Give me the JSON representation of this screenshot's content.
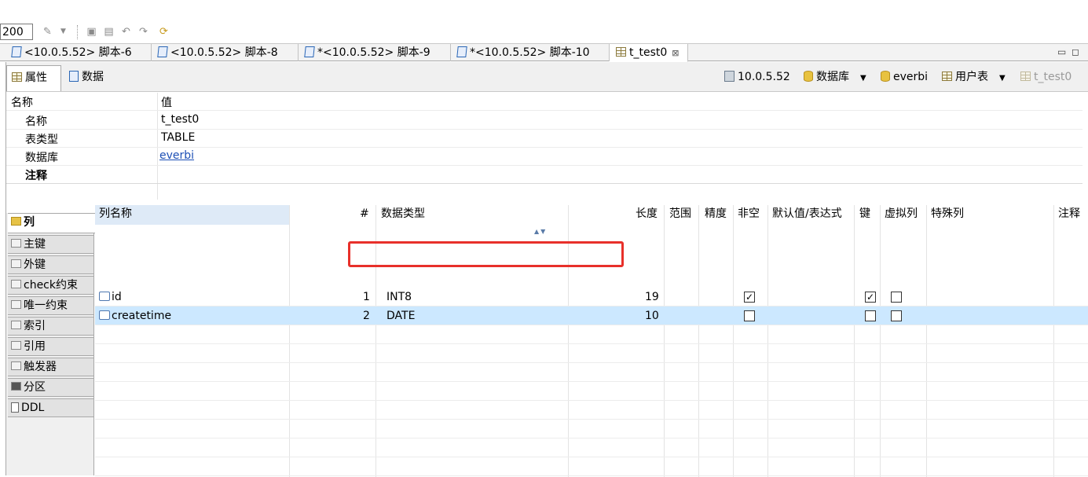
{
  "toolbar": {
    "zoom_value": "200"
  },
  "editor_tabs": [
    {
      "label": "<10.0.5.52> 脚本-6"
    },
    {
      "label": "<10.0.5.52> 脚本-8"
    },
    {
      "label": "*<10.0.5.52> 脚本-9"
    },
    {
      "label": "*<10.0.5.52> 脚本-10"
    },
    {
      "label": "t_test0",
      "active": true
    }
  ],
  "sub_tabs": [
    {
      "label": "属性",
      "active": true
    },
    {
      "label": "数据"
    }
  ],
  "breadcrumb": {
    "server": "10.0.5.52",
    "database_type": "数据库",
    "database": "everbi",
    "table_type": "用户表",
    "table": "t_test0"
  },
  "properties": {
    "header_name": "名称",
    "header_value": "值",
    "rows": [
      {
        "name": "名称",
        "value": "t_test0"
      },
      {
        "name": "表类型",
        "value": "TABLE"
      },
      {
        "name": "数据库",
        "value": "everbi"
      },
      {
        "name": "注释",
        "value": ""
      }
    ]
  },
  "vertical_tabs": [
    {
      "label": "列",
      "active": true
    },
    {
      "label": "主键"
    },
    {
      "label": "外键"
    },
    {
      "label": "check约束"
    },
    {
      "label": "唯一约束"
    },
    {
      "label": "索引"
    },
    {
      "label": "引用"
    },
    {
      "label": "触发器"
    },
    {
      "label": "分区"
    },
    {
      "label": "DDL"
    }
  ],
  "columns_grid": {
    "headers": {
      "name": "列名称",
      "num": "#",
      "type": "数据类型",
      "length": "长度",
      "range": "范围",
      "precision": "精度",
      "notnull": "非空",
      "default": "默认值/表达式",
      "key": "键",
      "virtual": "虚拟列",
      "special": "特殊列",
      "comment": "注释"
    },
    "rows": [
      {
        "name": "id",
        "num": "1",
        "type": "INT8",
        "length": "19",
        "notnull": true,
        "key": true,
        "virtual": false
      },
      {
        "name": "createtime",
        "num": "2",
        "type": "DATE",
        "length": "10",
        "notnull": false,
        "key": false,
        "virtual": false,
        "selected": true
      }
    ]
  },
  "check_mark": "✓"
}
